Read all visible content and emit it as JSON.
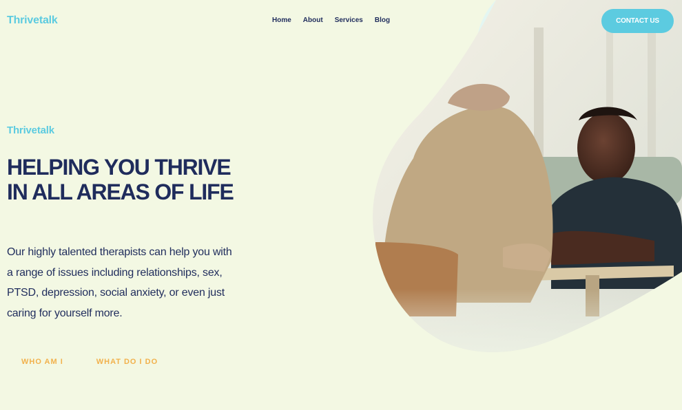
{
  "header": {
    "logo": "Thrivetalk",
    "nav": [
      "Home",
      "About",
      "Services",
      "Blog"
    ],
    "contact_label": "CONTACT US"
  },
  "hero": {
    "brand": "Thrivetalk",
    "title_line1": "HELPING YOU THRIVE",
    "title_line2": "IN ALL AREAS OF LIFE",
    "description": "Our highly talented therapists can help you with a range of issues including relationships, sex, PTSD, depression, social anxiety, or even just caring for yourself more.",
    "cta_who": "WHO AM I",
    "cta_what": "WHAT DO I DO",
    "image_icon": "therapy-session-photo"
  },
  "colors": {
    "background": "#f3f8e3",
    "accent": "#5ccbe0",
    "navy": "#1f2c5c",
    "orange": "#f2b14c",
    "light_blue_shape": "#e3f6f2"
  }
}
